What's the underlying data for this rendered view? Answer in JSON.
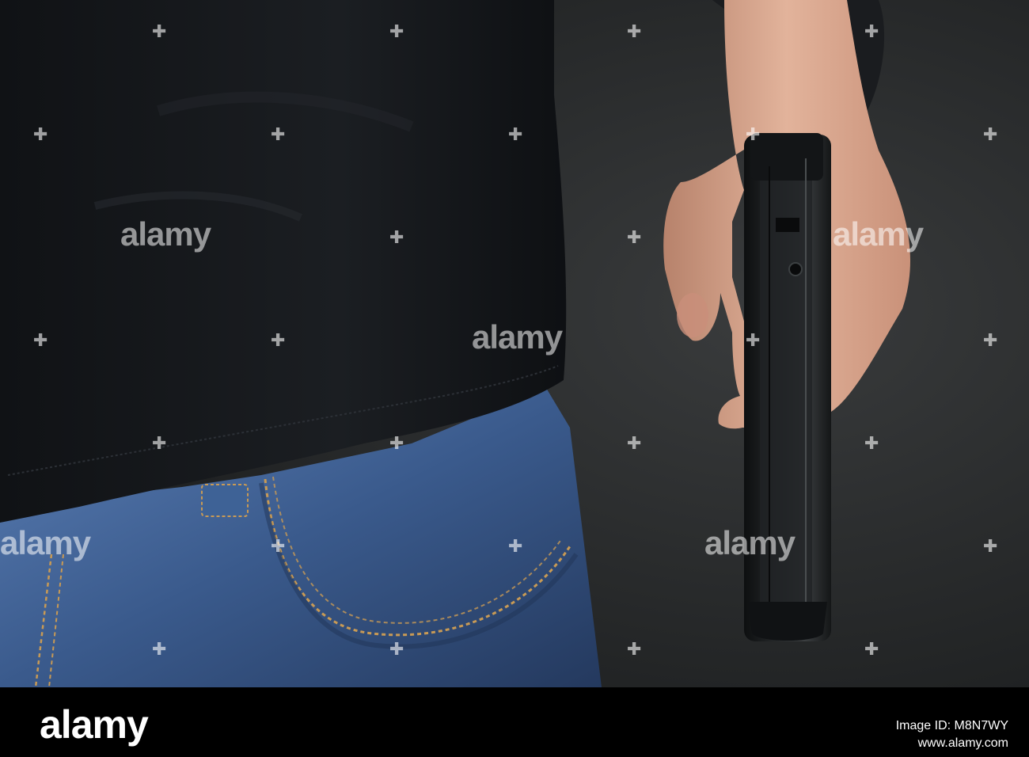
{
  "image": {
    "subject": "person-holding-handgun",
    "colors": {
      "background": "#2e3031",
      "shirt": "#16181b",
      "denim": "#3a5a8c",
      "stitch": "#c89a55",
      "skin": "#d8a990",
      "gun": "#1f2224"
    }
  },
  "watermark": {
    "text": "alamy"
  },
  "footer": {
    "logo": "alamy",
    "image_id": "Image ID: M8N7WY",
    "url": "www.alamy.com"
  }
}
